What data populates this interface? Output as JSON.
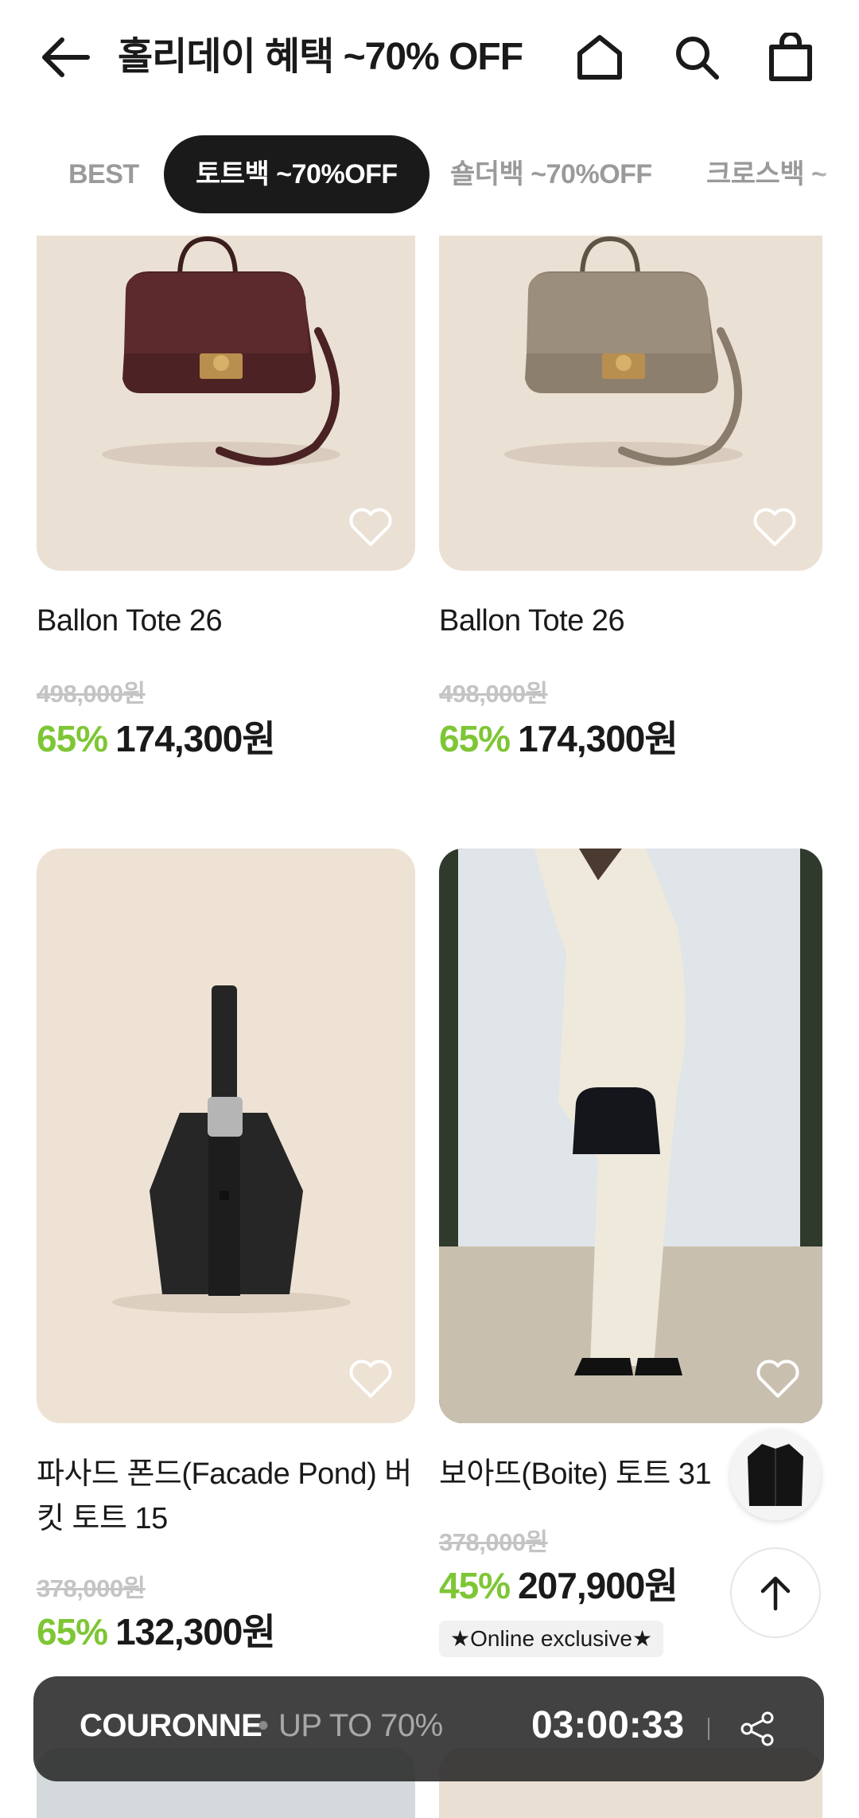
{
  "header": {
    "title": "홀리데이 혜택 ~70% OFF"
  },
  "tabs": [
    {
      "label": "BEST",
      "active": false
    },
    {
      "label": "토트백 ~70%OFF",
      "active": true
    },
    {
      "label": "숄더백 ~70%OFF",
      "active": false
    },
    {
      "label": "크로스백 ~",
      "active": false
    }
  ],
  "products": [
    {
      "name": "Ballon Tote 26",
      "original_price": "498,000원",
      "discount": "65%",
      "price": "174,300원"
    },
    {
      "name": "Ballon Tote 26",
      "original_price": "498,000원",
      "discount": "65%",
      "price": "174,300원"
    },
    {
      "name": "파사드 폰드(Facade Pond) 버킷 토트 15",
      "original_price": "378,000원",
      "discount": "65%",
      "price": "132,300원"
    },
    {
      "name": "보아뜨(Boite) 토트 31",
      "original_price": "378,000원",
      "discount": "45%",
      "price": "207,900원",
      "badge": "★Online exclusive★"
    }
  ],
  "promo": {
    "brand": "COURONNE",
    "separator": "•",
    "tagline": "UP TO 70%",
    "timer": "03:00:33"
  },
  "colors": {
    "discount": "#7ec635",
    "tab_active_bg": "#1a1a1a",
    "promo_bg": "#282828"
  },
  "icons": [
    "back-arrow-icon",
    "home-icon",
    "search-icon",
    "shopping-bag-icon",
    "heart-icon",
    "arrow-up-icon",
    "share-icon"
  ]
}
